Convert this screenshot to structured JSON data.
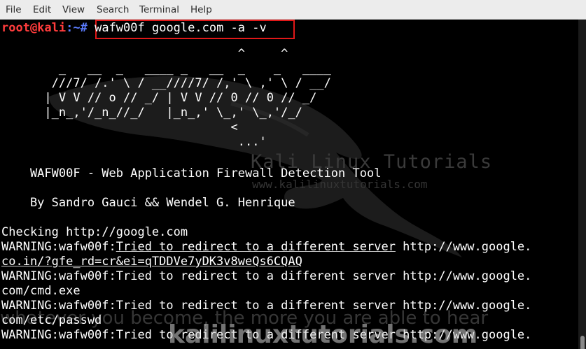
{
  "menu": [
    "File",
    "Edit",
    "View",
    "Search",
    "Terminal",
    "Help"
  ],
  "prompt": {
    "user_host": "root@kali",
    "separator": ":~#",
    "command": "wafw00f google.com -a -v"
  },
  "banner": [
    "                                 ^     ^",
    "        _   __  _   ____ _   __  _    _   ____",
    "       ///7/ /.' \\ / __////7/ /,' \\ ,' \\ / __/",
    "      | V V // o // _/ | V V // 0 // 0 // _/",
    "      |_n_,'/_n_//_/   |_n_,' \\_,' \\_,'/_/",
    "                                <",
    "                                 ...'"
  ],
  "tool_title": "    WAFW00F - Web Application Firewall Detection Tool",
  "authors": "    By Sandro Gauci && Wendel G. Henrique",
  "output": {
    "checking": "Checking http://google.com",
    "warning_prefix": "WARNING:wafw00f:",
    "redirect_msg": "Tried to redirect to a different server",
    "w1_url_a": " http://www.google.",
    "w1_url_b": "co.in/?gfe_rd=cr&ei=qTDDVe7yDK3v8weQs6CQAQ",
    "w2_url_a": " http://www.google.",
    "w2_url_b": "com/cmd.exe",
    "w3_url_a": " http://www.google.",
    "w3_url_b": "com/etc/passwd",
    "w4_url_a": " http://www.google."
  },
  "watermark": {
    "title": "Kali Linux Tutorials",
    "url": "www.kalilinuxtutorials.com",
    "bottom": "kalilinuxtutorials.com",
    "bottom_sub": "whatever you become, the more you are able to hear"
  },
  "colors": {
    "prompt_user": "#ff3c3c",
    "prompt_path": "#5b7cff",
    "highlight_box": "#e01818"
  }
}
